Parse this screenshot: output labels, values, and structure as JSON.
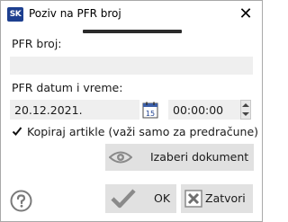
{
  "window": {
    "app_icon_text": "SK",
    "title": "Poziv na PFR broj",
    "close_symbol": "✕"
  },
  "form": {
    "pfr_label": "PFR broj:",
    "pfr_value": "",
    "datetime_label": "PFR datum i vreme:",
    "date_value": "20.12.2021.",
    "calendar_day": "15",
    "time_value": "00:00:00",
    "copy_items_label": "Kopiraj artikle (važi samo za predračune)",
    "copy_items_checked": true
  },
  "buttons": {
    "select_document": "Izaberi dokument",
    "ok": "OK",
    "close": "Zatvori"
  },
  "icons": {
    "app": "sk-logo-icon",
    "close": "close-icon",
    "calendar": "calendar-icon",
    "spin_up": "spin-up-icon",
    "spin_down": "spin-down-icon",
    "checkbox": "checkmark-icon",
    "eye": "eye-icon",
    "ok": "checkmark-icon",
    "cancel": "x-box-icon",
    "help": "help-icon"
  },
  "colors": {
    "app_icon_bg": "#1d3f8f",
    "field_bg": "#efefef",
    "button_bg": "#e1e1e1",
    "icon_gray": "#8a8a8a"
  }
}
